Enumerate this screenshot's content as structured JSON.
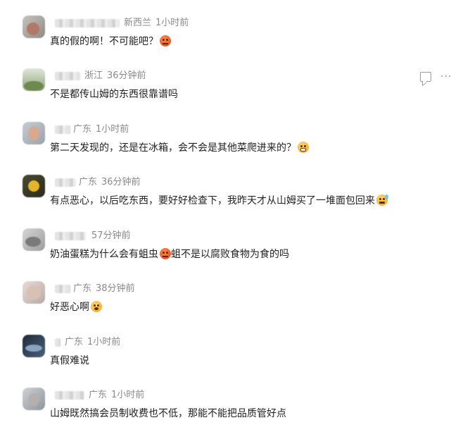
{
  "comments": [
    {
      "location": "新西兰",
      "time": "1小时前",
      "text": "真的假的啊！不可能吧？",
      "emoji": "angry-emoji"
    },
    {
      "location": "浙江",
      "time": "36分钟前",
      "text": "不是都传山姆的东西很靠谱吗",
      "emoji": ""
    },
    {
      "location": "广东",
      "time": "1小时前",
      "text": "第二天发现的，还是在冰箱，会不会是其他菜爬进来的？",
      "emoji": "grin-emoji"
    },
    {
      "location": "广东",
      "time": "36分钟前",
      "text": "有点恶心，以后吃东西，要好好检查下，我昨天才从山姆买了一堆面包回来",
      "emoji": "sweat-emoji"
    },
    {
      "location": "",
      "time": "57分钟前",
      "text": "奶油蛋糕为什么会有蛆虫",
      "text2": "蛆不是以腐败食物为食的吗",
      "emoji": "angry-emoji"
    },
    {
      "location": "广东",
      "time": "38分钟前",
      "text": "好恶心啊",
      "emoji": "sick-emoji"
    },
    {
      "location": "广东",
      "time": "1小时前",
      "text": "真假难说",
      "emoji": ""
    },
    {
      "location": "广东",
      "time": "1小时前",
      "text": "山姆既然搞会员制收费也不低，那能不能把品质管好点",
      "emoji": ""
    }
  ],
  "icons": {
    "reply": "comment-icon",
    "more": "more-icon"
  }
}
